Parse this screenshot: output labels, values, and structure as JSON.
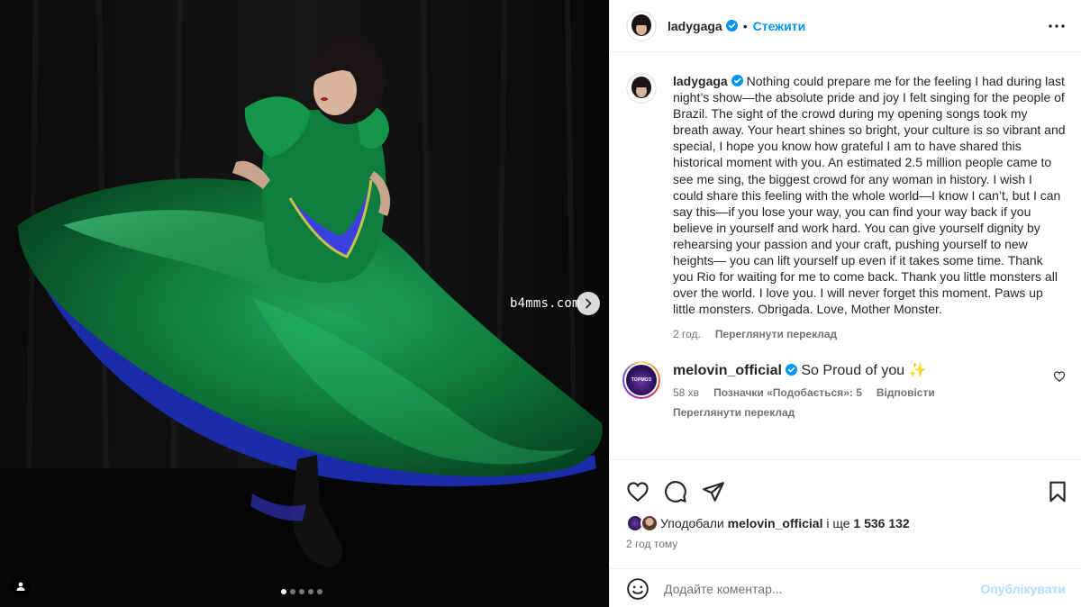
{
  "media": {
    "watermark": "b4mms.com",
    "carousel_count": 5,
    "carousel_active_index": 0
  },
  "header": {
    "username": "ladygaga",
    "separator": "•",
    "follow_label": "Стежити"
  },
  "caption": {
    "username": "ladygaga",
    "text": "Nothing could prepare me for the feeling I had during last night’s show—the absolute pride and joy I felt singing for the people of Brazil. The sight of the crowd during my opening songs took my breath away. Your heart shines so bright, your culture is so vibrant and special, I hope you know how grateful I am to have shared this historical moment with you. An estimated 2.5 million people came to see me sing, the biggest crowd for any woman in history. I wish I could share this feeling with the whole world—I know I can’t, but I can say this—if you lose your way, you can find your way back if you believe in yourself and work hard. You can give yourself dignity by rehearsing your passion and your craft, pushing yourself to new heights— you can lift yourself up even if it takes some time. Thank you Rio for waiting for me to come back. Thank you little monsters all over the world. I love you. I will never forget this moment. Paws up little monsters. Obrigada. Love, Mother Monster.",
    "time": "2 год.",
    "translate_label": "Переглянути переклад"
  },
  "comment": {
    "username": "melovin_official",
    "text": "So Proud of you ✨",
    "avatar_text": "ТОРМОЗ",
    "time": "58 хв",
    "likes_label": "Позначки «Подобається»: 5",
    "reply_label": "Відповісти",
    "translate_label": "Переглянути переклад"
  },
  "likes": {
    "prefix": "Уподобали",
    "user": "melovin_official",
    "middle": "і ще",
    "count": "1 536 132"
  },
  "post_time": "2 год тому",
  "add_comment": {
    "placeholder": "Додайте коментар...",
    "publish_label": "Опублікувати"
  },
  "icons": {
    "like": "heart-icon",
    "comment": "comment-icon",
    "share": "share-icon",
    "save": "bookmark-icon",
    "more": "more-icon",
    "verified": "verified-badge-icon",
    "emoji": "emoji-icon",
    "tag": "user-tag-icon",
    "next": "chevron-right-icon"
  },
  "colors": {
    "accent": "#0095f6",
    "verified": "#0095f6",
    "publish_disabled": "#b3dbff",
    "dress_green": "#0f7a3c"
  }
}
